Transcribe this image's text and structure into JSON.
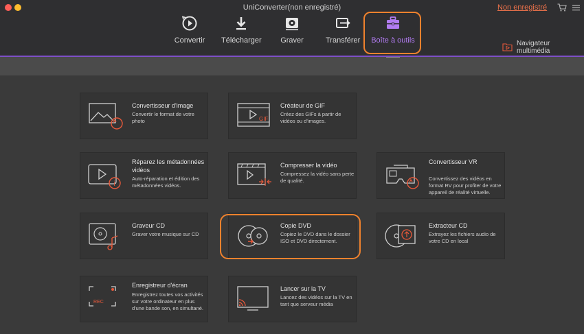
{
  "window": {
    "title": "UniConverter(non enregistré)",
    "unregistered_link": "Non enregistré"
  },
  "nav": {
    "items": [
      {
        "label": "Convertir",
        "icon": "convert-icon"
      },
      {
        "label": "Télécharger",
        "icon": "download-icon"
      },
      {
        "label": "Graver",
        "icon": "burn-disc-icon"
      },
      {
        "label": "Transférer",
        "icon": "transfer-icon"
      },
      {
        "label": "Boîte à outils",
        "icon": "toolbox-icon",
        "active": true
      }
    ],
    "media_browser": "Navigateur multimédia"
  },
  "tools": [
    {
      "title": "Convertisseur d'image",
      "desc": "Convertir le format de votre photo",
      "icon": "image-converter-icon"
    },
    {
      "title": "Créateur de GIF",
      "desc": "Créez des GIFs à partir de vidéos ou d'images.",
      "icon": "gif-maker-icon"
    },
    {
      "title": "Réparez les métadonnées vidéos",
      "desc": "Auto-réparation et édition des métadonnées vidéos.",
      "icon": "fix-metadata-icon"
    },
    {
      "title": "Compresser la vidéo",
      "desc": "Compressez la vidéo sans perte de qualité.",
      "icon": "compress-video-icon"
    },
    {
      "title": "Convertisseur VR",
      "desc": "Convertissez des vidéos en format RV pour profiter de votre appareil de réalité virtuelle.",
      "icon": "vr-converter-icon"
    },
    {
      "title": "Graveur CD",
      "desc": "Graver votre musique sur CD",
      "icon": "cd-burner-icon"
    },
    {
      "title": "Copie DVD",
      "desc": "Copiez le DVD dans le dossier ISO et DVD directement.",
      "icon": "dvd-copy-icon"
    },
    {
      "title": "Extracteur CD",
      "desc": "Extrayez les fichiers audio de votre CD en local",
      "icon": "cd-ripper-icon"
    },
    {
      "title": "Enregistreur d'écran",
      "desc": "Enregistrez toutes vos activités sur votre ordinateur en plus d'une bande son, en simultané.",
      "icon": "screen-recorder-icon",
      "badge": "REC"
    },
    {
      "title": "Lancer sur la TV",
      "desc": "Lancez des vidéos sur la TV en tant que serveur média",
      "icon": "cast-to-tv-icon"
    }
  ],
  "colors": {
    "accent": "#b27cf2",
    "highlight": "#f0822d",
    "icon_red": "#e8593a",
    "unregistered": "#f0734b"
  }
}
